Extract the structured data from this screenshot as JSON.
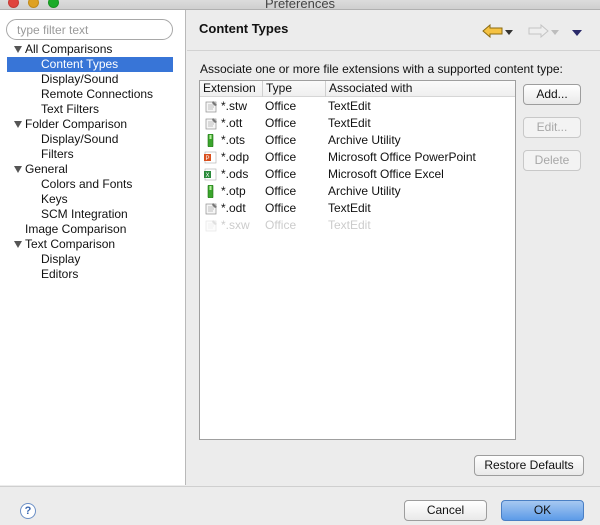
{
  "window": {
    "title": "Preferences"
  },
  "sidebar": {
    "filter_placeholder": "type filter text",
    "items": [
      {
        "label": "All Comparisons",
        "level": 0,
        "expandable": true,
        "selected": false
      },
      {
        "label": "Content Types",
        "level": 1,
        "expandable": false,
        "selected": true
      },
      {
        "label": "Display/Sound",
        "level": 1,
        "expandable": false,
        "selected": false
      },
      {
        "label": "Remote Connections",
        "level": 1,
        "expandable": false,
        "selected": false
      },
      {
        "label": "Text Filters",
        "level": 1,
        "expandable": false,
        "selected": false
      },
      {
        "label": "Folder Comparison",
        "level": 0,
        "expandable": true,
        "selected": false
      },
      {
        "label": "Display/Sound",
        "level": 1,
        "expandable": false,
        "selected": false
      },
      {
        "label": "Filters",
        "level": 1,
        "expandable": false,
        "selected": false
      },
      {
        "label": "General",
        "level": 0,
        "expandable": true,
        "selected": false
      },
      {
        "label": "Colors and Fonts",
        "level": 1,
        "expandable": false,
        "selected": false
      },
      {
        "label": "Keys",
        "level": 1,
        "expandable": false,
        "selected": false
      },
      {
        "label": "SCM Integration",
        "level": 1,
        "expandable": false,
        "selected": false
      },
      {
        "label": "Image Comparison",
        "level": 0,
        "expandable": false,
        "selected": false
      },
      {
        "label": "Text Comparison",
        "level": 0,
        "expandable": true,
        "selected": false
      },
      {
        "label": "Display",
        "level": 1,
        "expandable": false,
        "selected": false
      },
      {
        "label": "Editors",
        "level": 1,
        "expandable": false,
        "selected": false
      }
    ]
  },
  "main": {
    "title": "Content Types",
    "description": "Associate one or more file extensions with a supported content type:",
    "table": {
      "headers": [
        "Extension",
        "Type",
        "Associated with"
      ],
      "rows": [
        {
          "ext": "*.stw",
          "type": "Office",
          "app": "TextEdit",
          "icon": "textedit-icon",
          "faded": false
        },
        {
          "ext": "*.ott",
          "type": "Office",
          "app": "TextEdit",
          "icon": "textedit-icon",
          "faded": false
        },
        {
          "ext": "*.ots",
          "type": "Office",
          "app": "Archive Utility",
          "icon": "archive-icon",
          "faded": false
        },
        {
          "ext": "*.odp",
          "type": "Office",
          "app": "Microsoft Office PowerPoint",
          "icon": "powerpoint-icon",
          "faded": false
        },
        {
          "ext": "*.ods",
          "type": "Office",
          "app": "Microsoft Office Excel",
          "icon": "excel-icon",
          "faded": false
        },
        {
          "ext": "*.otp",
          "type": "Office",
          "app": "Archive Utility",
          "icon": "archive-icon",
          "faded": false
        },
        {
          "ext": "*.odt",
          "type": "Office",
          "app": "TextEdit",
          "icon": "textedit-icon",
          "faded": false
        },
        {
          "ext": "*.sxw",
          "type": "Office",
          "app": "TextEdit",
          "icon": "textedit-icon",
          "faded": true
        }
      ]
    },
    "buttons": {
      "add": "Add...",
      "edit": "Edit...",
      "delete": "Delete",
      "restore_defaults": "Restore Defaults"
    }
  },
  "footer": {
    "help": "?",
    "cancel": "Cancel",
    "ok": "OK"
  },
  "colors": {
    "selection": "#3875d7",
    "ok_button": "#5c9be8"
  }
}
